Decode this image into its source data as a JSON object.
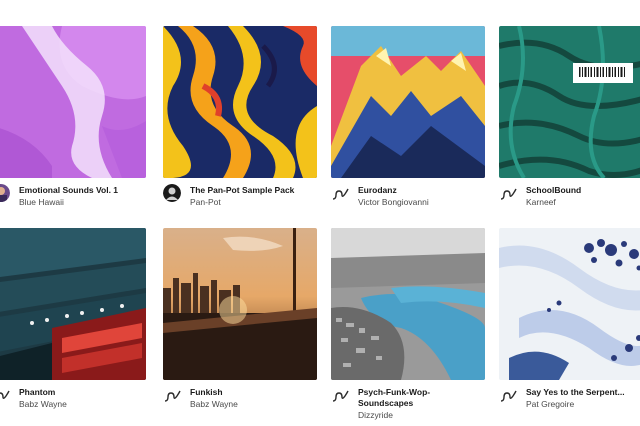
{
  "packs": [
    {
      "title": "Emotional Sounds Vol. 1",
      "artist": "Blue Hawaii",
      "owner_icon": "avatar-icon"
    },
    {
      "title": "The Pan-Pot Sample Pack",
      "artist": "Pan-Pot",
      "owner_icon": "avatar-icon"
    },
    {
      "title": "Eurodanz",
      "artist": "Victor Bongiovanni",
      "owner_icon": "waveform-icon"
    },
    {
      "title": "SchoolBound",
      "artist": "Karneef",
      "owner_icon": "waveform-icon"
    },
    {
      "title": "Phantom",
      "artist": "Babz Wayne",
      "owner_icon": "waveform-icon"
    },
    {
      "title": "Funkish",
      "artist": "Babz Wayne",
      "owner_icon": "waveform-icon"
    },
    {
      "title": "Psych-Funk-Wop-Soundscapes",
      "artist": "Dizzyride",
      "owner_icon": "waveform-icon"
    },
    {
      "title": "Say Yes to the Serpent...",
      "artist": "Pat Gregoire",
      "owner_icon": "waveform-icon"
    }
  ],
  "colors": {
    "text": "#1a1a1a",
    "muted": "#4a4a4a",
    "wave_icon": "#2b2b2b"
  }
}
